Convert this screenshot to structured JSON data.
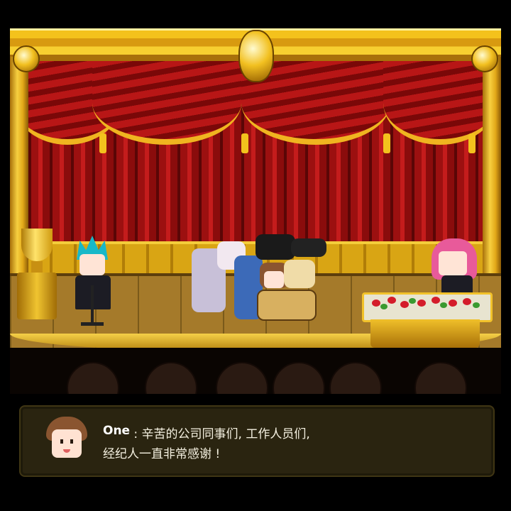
{
  "dialog": {
    "speaker": "One",
    "separator": " : ",
    "line1": "辛苦的公司同事们, 工作人员们,",
    "line2": "经纪人一直非常感谢 !"
  },
  "colors": {
    "curtain": "#b81616",
    "frame_gold": "#f4c21c",
    "dialog_bg": "#2a2410",
    "text": "#f4f0e0"
  }
}
